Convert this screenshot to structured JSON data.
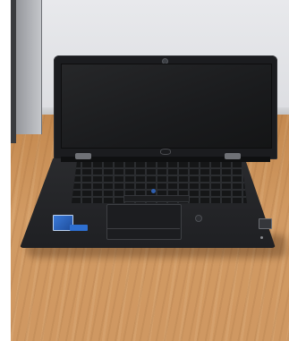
{
  "image": {
    "subject": "laptop",
    "colors": {
      "floor": "#c9925c",
      "wall": "#e0e1e4",
      "laptop_body": "#232427",
      "screen": "#1c1d1f"
    },
    "icons": [
      "webcam-icon",
      "trackpoint-icon",
      "fingerprint-reader-icon",
      "smartcard-slot-icon"
    ]
  }
}
